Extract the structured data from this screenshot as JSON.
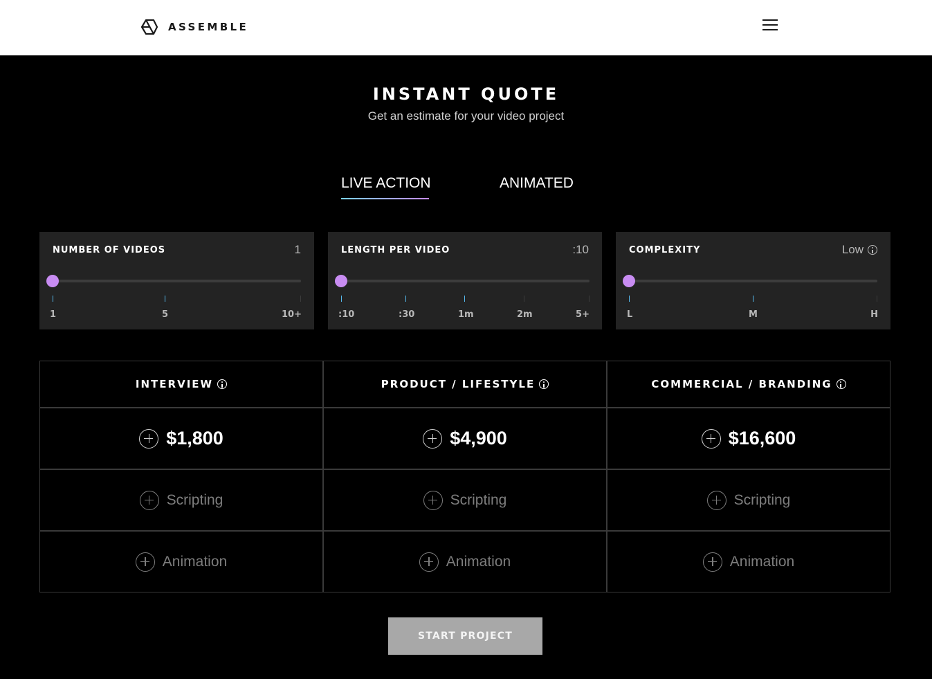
{
  "header": {
    "logo_text": "ASSEMBLE",
    "logo_icon": "assemble-logo-icon",
    "menu_icon": "hamburger-menu-icon"
  },
  "hero": {
    "title": "INSTANT QUOTE",
    "subtitle": "Get an estimate for your video project"
  },
  "tabs": [
    {
      "label": "LIVE ACTION",
      "active": true
    },
    {
      "label": "ANIMATED",
      "active": false
    }
  ],
  "sliders": {
    "videos": {
      "label": "NUMBER OF VIDEOS",
      "value": "1",
      "ticks": [
        "1",
        "5",
        "10+"
      ]
    },
    "length": {
      "label": "LENGTH PER VIDEO",
      "value": ":10",
      "ticks": [
        ":10",
        ":30",
        "1m",
        "2m",
        "5+"
      ]
    },
    "complexity": {
      "label": "COMPLEXITY",
      "value": "Low",
      "ticks": [
        "L",
        "M",
        "H"
      ]
    }
  },
  "quote_columns": [
    {
      "header": "INTERVIEW",
      "price": "$1,800",
      "addons": [
        "Scripting",
        "Animation"
      ]
    },
    {
      "header": "PRODUCT / LIFESTYLE",
      "price": "$4,900",
      "addons": [
        "Scripting",
        "Animation"
      ]
    },
    {
      "header": "COMMERCIAL / BRANDING",
      "price": "$16,600",
      "addons": [
        "Scripting",
        "Animation"
      ]
    }
  ],
  "cta": {
    "label": "START PROJECT"
  },
  "colors": {
    "accent_thumb": "#c88cf2",
    "tick_blue": "#55b9ee",
    "panel_bg": "#232323",
    "button_bg": "#a8a8a8"
  }
}
